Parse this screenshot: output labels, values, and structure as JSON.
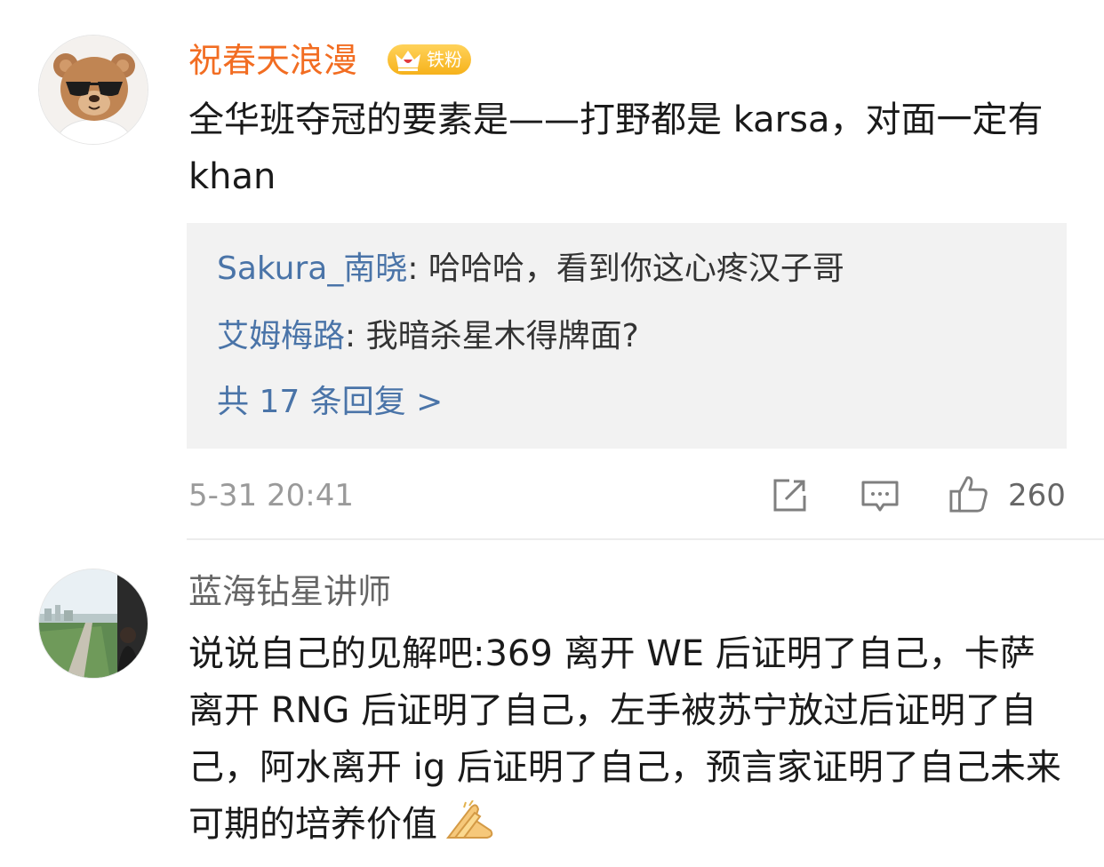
{
  "comments": [
    {
      "username": "祝春天浪漫",
      "badge": "铁粉",
      "text": "全华班夺冠的要素是——打野都是 karsa，对面一定有 khan",
      "replies": [
        {
          "author": "Sakura_南晓",
          "text": ": 哈哈哈，看到你这心疼汉子哥"
        },
        {
          "author": "艾姆梅路",
          "text": ": 我暗杀星木得牌面?"
        }
      ],
      "more_replies": "共 17 条回复 >",
      "time": "5-31 20:41",
      "likes": "260"
    },
    {
      "username": "蓝海钻星讲师",
      "text": "说说自己的见解吧:369 离开 WE 后证明了自己，卡萨离开 RNG 后证明了自己，左手被苏宁放过后证明了自己，阿水离开 ig 后证明了自己，预言家证明了自己未来可期的培养价值",
      "emoji": "folded-hands"
    }
  ],
  "colors": {
    "username_orange": "#f26d22",
    "link_blue": "#4a74a8",
    "reply_bg": "#f2f2f2",
    "meta_gray": "#9a9a9a"
  },
  "icons": {
    "share": "share-icon",
    "comment": "comment-icon",
    "like": "thumbs-up-icon",
    "badge": "crown-icon"
  }
}
